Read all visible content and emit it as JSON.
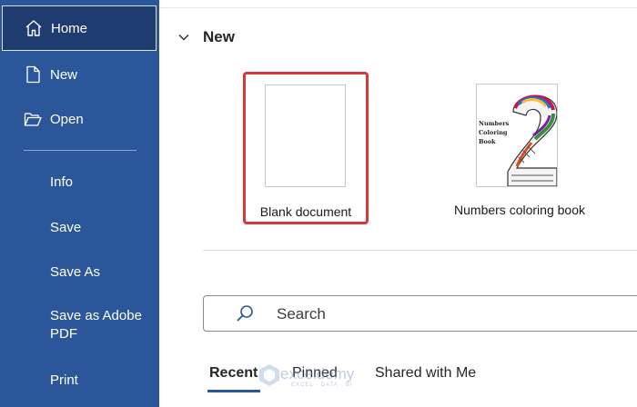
{
  "sidebar": {
    "items": [
      {
        "label": "Home",
        "icon": "home-icon",
        "active": true
      },
      {
        "label": "New",
        "icon": "new-document-icon"
      },
      {
        "label": "Open",
        "icon": "folder-open-icon"
      },
      {
        "label": "Info"
      },
      {
        "label": "Save"
      },
      {
        "label": "Save As"
      },
      {
        "label": "Save as Adobe PDF"
      },
      {
        "label": "Print"
      }
    ]
  },
  "main": {
    "section_title": "New",
    "templates": [
      {
        "label": "Blank document",
        "selected": true
      },
      {
        "label": "Numbers coloring book",
        "thumbnail_text": "Numbers Coloring Book"
      }
    ],
    "search": {
      "placeholder": "Search"
    },
    "tabs": [
      {
        "label": "Recent",
        "active": true
      },
      {
        "label": "Pinned"
      },
      {
        "label": "Shared with Me"
      }
    ]
  },
  "watermark": {
    "name": "exceldemy",
    "tagline": "EXCEL · DATA · BI"
  },
  "colors": {
    "sidebar_bg": "#2b579a",
    "active_item_bg": "#1f3c70",
    "selection_border": "#d33b3b",
    "tab_underline": "#2b579a"
  }
}
